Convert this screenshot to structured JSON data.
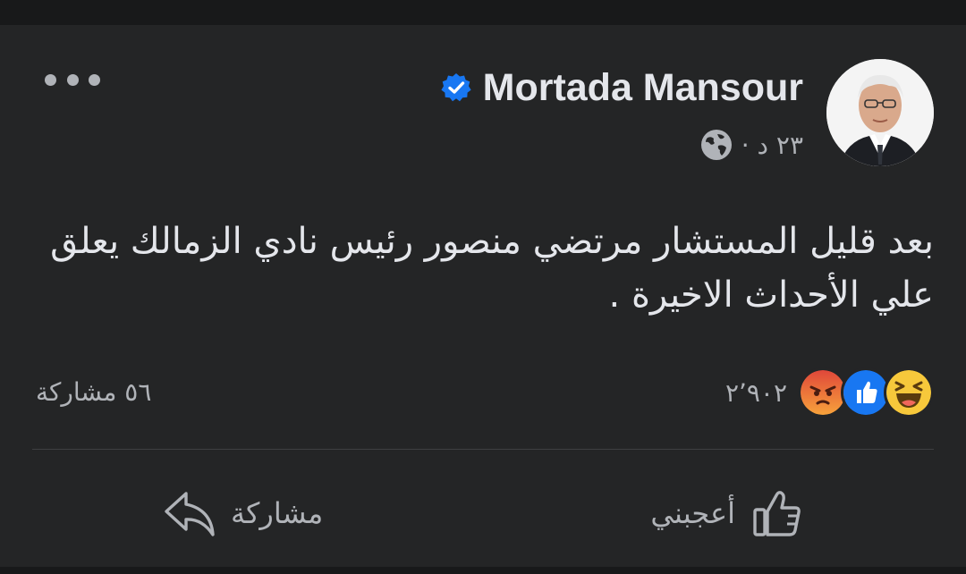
{
  "post": {
    "author_name": "Mortada Mansour",
    "time": "٢٣ د ·",
    "text": "بعد قليل المستشار مرتضي منصور رئيس نادي الزمالك يعلق علي الأحداث الاخيرة ."
  },
  "reactions": {
    "count": "٢٬٩٠٢",
    "icons": [
      "haha-reaction-icon",
      "like-reaction-icon",
      "angry-reaction-icon"
    ]
  },
  "shares": {
    "label": "٥٦ مشاركة"
  },
  "actions": {
    "like_label": "أعجبني",
    "share_label": "مشاركة"
  },
  "colors": {
    "background": "#18191a",
    "card": "#242526",
    "text_primary": "#e4e6eb",
    "text_secondary": "#b0b3b8",
    "verified_blue": "#1877f2",
    "haha_yellow": "#f7c83b",
    "angry_orange": "#f0733b"
  }
}
